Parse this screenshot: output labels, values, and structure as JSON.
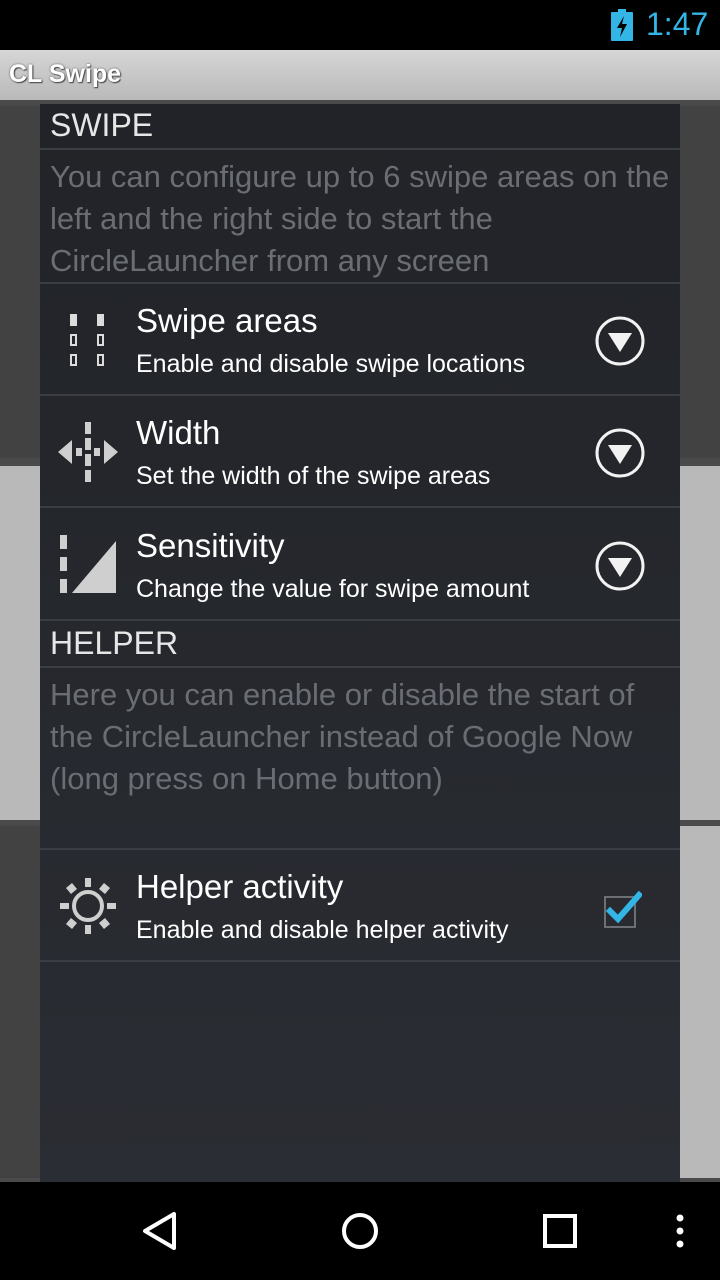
{
  "status_bar": {
    "time": "1:47",
    "battery_icon": "battery-charging-icon"
  },
  "app_bar": {
    "title": "CL Swipe"
  },
  "swipe_section": {
    "header": "SWIPE",
    "description": "You can configure up to 6 swipe areas on the left and the right side to start the CircleLauncher from any screen",
    "items": [
      {
        "title": "Swipe areas",
        "summary": "Enable and disable swipe locations",
        "icon": "swipe-areas-icon",
        "control": "dropdown-arrow-icon"
      },
      {
        "title": "Width",
        "summary": "Set the width of the swipe areas",
        "icon": "width-icon",
        "control": "dropdown-arrow-icon"
      },
      {
        "title": "Sensitivity",
        "summary": "Change the value for swipe amount",
        "icon": "sensitivity-icon",
        "control": "dropdown-arrow-icon"
      }
    ]
  },
  "helper_section": {
    "header": "HELPER",
    "description": "Here you can enable or disable the start of the CircleLauncher instead of Google Now (long press on Home button)",
    "items": [
      {
        "title": "Helper activity",
        "summary": "Enable and disable helper activity",
        "icon": "helper-icon",
        "checked": true
      }
    ]
  },
  "nav_bar": {
    "icons": [
      "back-icon",
      "home-icon",
      "recents-icon",
      "overflow-menu-icon"
    ]
  },
  "colors": {
    "accent": "#33b5e5",
    "panel": "#212328",
    "divider": "#3a3d42",
    "description_text": "#6a6d73"
  }
}
